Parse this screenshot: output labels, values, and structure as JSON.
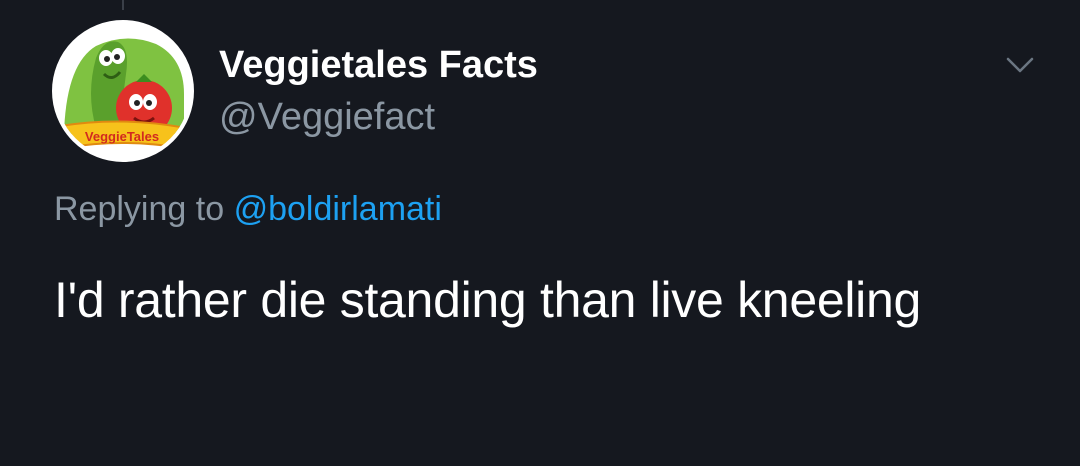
{
  "tweet": {
    "display_name": "Veggietales Facts",
    "handle": "@Veggiefact",
    "reply_prefix": "Replying to",
    "reply_mention": "@boldirlamati",
    "text": "I'd rather die standing than live kneeling"
  },
  "avatar": {
    "logo_text": "VeggieTales",
    "icon": "veggietales-logo"
  },
  "menu": {
    "icon": "chevron-down-icon"
  },
  "colors": {
    "background": "#15181f",
    "primary_text": "#ffffff",
    "secondary_text": "#8b97a3",
    "link": "#1da1f2"
  }
}
